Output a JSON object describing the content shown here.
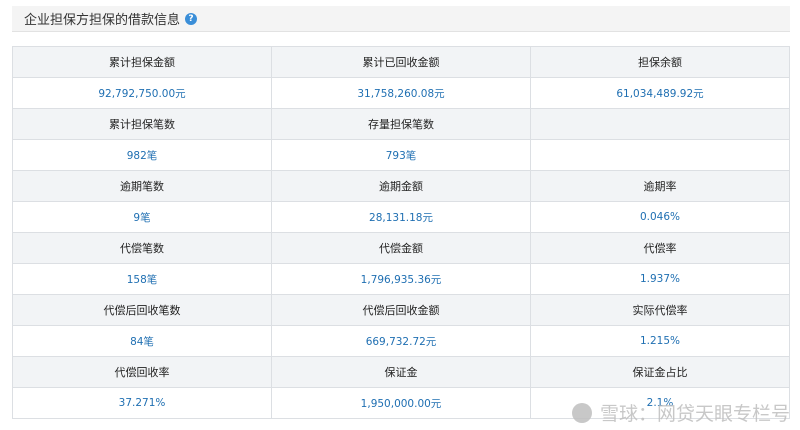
{
  "header": {
    "title": "企业担保方担保的借款信息",
    "help_icon": "?"
  },
  "rows": [
    {
      "labels": [
        "累计担保金额",
        "累计已回收金额",
        "担保余额"
      ],
      "values": [
        "92,792,750.00元",
        "31,758,260.08元",
        "61,034,489.92元"
      ]
    },
    {
      "labels": [
        "累计担保笔数",
        "存量担保笔数",
        ""
      ],
      "values": [
        "982笔",
        "793笔",
        ""
      ]
    },
    {
      "labels": [
        "逾期笔数",
        "逾期金额",
        "逾期率"
      ],
      "values": [
        "9笔",
        "28,131.18元",
        "0.046%"
      ]
    },
    {
      "labels": [
        "代偿笔数",
        "代偿金额",
        "代偿率"
      ],
      "values": [
        "158笔",
        "1,796,935.36元",
        "1.937%"
      ]
    },
    {
      "labels": [
        "代偿后回收笔数",
        "代偿后回收金额",
        "实际代偿率"
      ],
      "values": [
        "84笔",
        "669,732.72元",
        "1.215%"
      ]
    },
    {
      "labels": [
        "代偿回收率",
        "保证金",
        "保证金占比"
      ],
      "values": [
        "37.271%",
        "1,950,000.00元",
        "2.1%"
      ]
    }
  ],
  "watermark": {
    "text": "雪球：网贷天眼专栏号"
  },
  "colors": {
    "value_text": "#1f6fb2",
    "label_bg": "#f2f4f6",
    "border": "#dcdfe3",
    "help_icon": "#3a8ed8"
  }
}
